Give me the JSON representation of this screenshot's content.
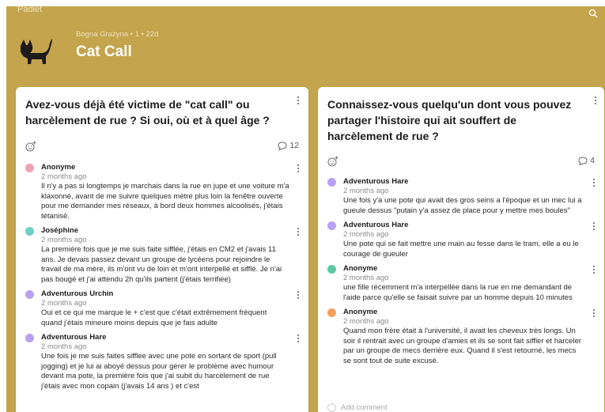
{
  "app": {
    "brand": "Padlet"
  },
  "board": {
    "meta": "Bogna Grażyna • 1 • 22d",
    "title": "Cat Call"
  },
  "columns": [
    {
      "title": "Avez-vous déjà été victime de \"cat call\" ou harcèlement de rue ? Si oui, où et à quel âge ?",
      "comment_count": "12",
      "comments": [
        {
          "name": "Anonyme",
          "time": "2 months ago",
          "text": "Il n'y a pas si longtemps je marchais dans la rue en jupe et une voiture m'a klaxonné, avant de me suivre quelques mètre plus loin la fenêtre ouverte pour me demander mes réseaux, à bord deux hommes alcoolisés, j'étais tétanisé."
        },
        {
          "name": "Joséphine",
          "time": "2 months ago",
          "text": "La première fois que je me suis faite sifflée, j'étais en CM2 et j'avais 11 ans. Je devais passez devant un groupe de lycéens pour rejoindre le travail de ma mère, ils m'ont vu de loin et m'ont interpellé et sifflé. Je n'ai pas bougé et j'ai attendu 2h qu'ils partent (j'étais terrifiée)"
        },
        {
          "name": "Adventurous Urchin",
          "time": "2 months ago",
          "text": "Oui et ce qui me marque le + c'est que c'était extrêmement fréquent quand j'étais mineure moins depuis que je fais adulte"
        },
        {
          "name": "Adventurous Hare",
          "time": "2 months ago",
          "text": "Une fois je me suis faites sifflee avec une pote en sortant de sport (pull jogging) et je lui ai aboyé dessus pour gérer le problème avec humour  devant ma pote, la première fois que j'ai subit du harcèlement de rue j'étais avec mon copain (j'avais 14 ans ) et c'est"
        }
      ]
    },
    {
      "title": "Connaissez-vous quelqu'un dont vous pouvez partager l'histoire qui ait souffert de harcèlement de rue ?",
      "comment_count": "4",
      "add_comment": "Add comment",
      "comments": [
        {
          "name": "Adventurous Hare",
          "time": "2 months ago",
          "text": "Une fois y'a une pote qui avait des gros seins a l'époque et un mec lui a gueule dessus \"putain y'a assez de place pour y mettre mes boules\""
        },
        {
          "name": "Adventurous Hare",
          "time": "2 months ago",
          "text": "Une pote qui se fait mettre une main au fesse dans le tram, elle a eu le courage de gueuler"
        },
        {
          "name": "Anonyme",
          "time": "2 months ago",
          "text": "une fille récemment m'a interpellée dans la rue en me demandant de l'aide parce qu'elle se faisait suivre par un homme depuis 10 minutes"
        },
        {
          "name": "Anonyme",
          "time": "2 months ago",
          "text": "Quand mon frère était à l'université, il avait les cheveux très longs. Un soir il rentrait avec un groupe d'amies et ils se sont fait siffler et harceler par un groupe de mecs derrière eux. Quand il s'est retourné, les mecs se sont tout de suite excusé."
        }
      ]
    }
  ],
  "colors": {
    "board_bg": "#c4a44c",
    "avatar_pink": "#f3a1b6",
    "avatar_teal": "#6fd1c9",
    "avatar_purple": "#b8a1f0",
    "avatar_green": "#5cc9a4",
    "avatar_orange": "#f5a05a"
  },
  "icons": [
    "search-icon",
    "cat-avatar",
    "add-reaction-icon",
    "comment-icon",
    "more-vertical-icon"
  ]
}
